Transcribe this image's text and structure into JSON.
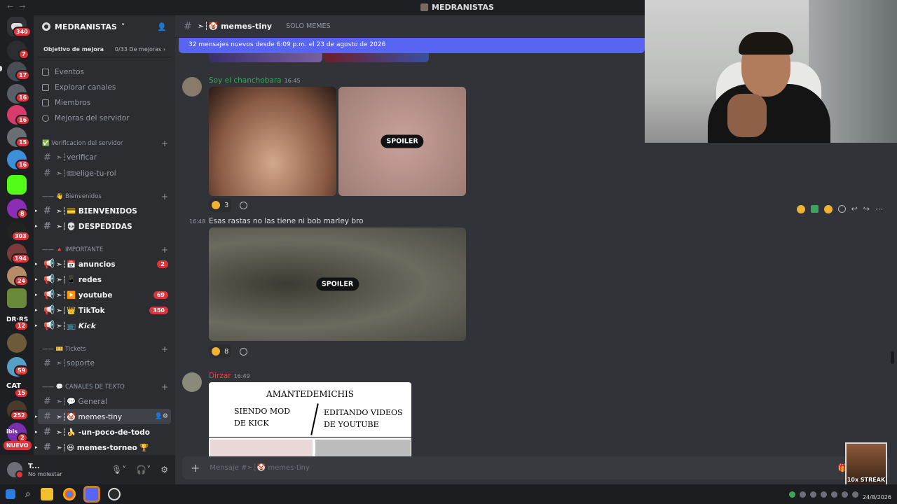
{
  "window": {
    "title": "MEDRANISTAS"
  },
  "rail": {
    "servers": [
      {
        "badge": "340"
      },
      {
        "badge": "7"
      },
      {
        "badge": "17"
      },
      {
        "badge": "16"
      },
      {
        "badge": "16"
      },
      {
        "badge": "15"
      },
      {
        "badge": "16"
      },
      {
        "badge": ""
      },
      {
        "badge": "8"
      },
      {
        "badge": "303"
      },
      {
        "badge": "194"
      },
      {
        "badge": "24"
      },
      {
        "badge": ""
      },
      {
        "badge": "12"
      },
      {
        "badge": ""
      },
      {
        "badge": "59"
      },
      {
        "badge": "15"
      },
      {
        "badge": "252"
      },
      {
        "badge": "2"
      }
    ],
    "text_dr": "DR·RS",
    "text_cat": "CAT",
    "text_ibis": "ibis",
    "nuevo": "NUEVO"
  },
  "sidebar": {
    "server_name": "MEDRANISTAS",
    "boost_label": "Objetivo de mejora",
    "boost_progress": "0/33 De mejoras",
    "menu": [
      "Eventos",
      "Explorar canales",
      "Miembros",
      "Mejoras del servidor"
    ],
    "categories": [
      {
        "name": "✅ Verificacion del servidor",
        "channels": [
          {
            "name": "➣┆verificar"
          },
          {
            "name": "➣┆🎟elige-tu-rol"
          }
        ]
      },
      {
        "name": "—— 👋 Bienvenidos",
        "channels": [
          {
            "name": "➣┆💳 𝗕𝗜𝗘𝗡𝗩𝗘𝗡𝗜𝗗𝗢𝗦"
          },
          {
            "name": "➣┆💀 𝗗𝗘𝗦𝗣𝗘𝗗𝗜𝗗𝗔𝗦"
          }
        ]
      },
      {
        "name": "—— 🔺 IMPORTANTE",
        "channels": [
          {
            "name": "➣┆📅 anuncios",
            "count": "2"
          },
          {
            "name": "➣┆📱 redes"
          },
          {
            "name": "➣┆▶️ youtube",
            "count": "69"
          },
          {
            "name": "➣┆👑 TikTok",
            "count": "350"
          },
          {
            "name": "➣┆📺 𝙆𝙞𝙘𝙠"
          }
        ]
      },
      {
        "name": "—— 🎫 Tickets",
        "channels": [
          {
            "name": "➣┆soporte"
          }
        ]
      },
      {
        "name": "—— 💬 CANALES DE TEXTO",
        "channels": [
          {
            "name": "➣┆💬 General"
          },
          {
            "name": "➣┆🤡 memes-tiny"
          },
          {
            "name": "➣┆🍌 -un-poco-de-todo"
          },
          {
            "name": "➣┆😆 memes-torneo 🏆"
          }
        ]
      }
    ]
  },
  "user": {
    "name": "T...",
    "status": "No molestar"
  },
  "chat": {
    "channel": "➣┆🤡 memes-tiny",
    "topic": "SOLO MEMES",
    "new_messages": "32 mensajes nuevos desde 6:09 p.m. el 23 de agosto de 2026",
    "messages": [
      {
        "author": "Soy el chanchobara",
        "author_color": "#3ba55c",
        "time": "16:45",
        "spoiler": "SPOILER",
        "reaction_count": "3"
      },
      {
        "time": "16:48",
        "text": "Esas rastas no las tiene ni bob marley bro",
        "spoiler": "SPOILER",
        "reaction_count": "8"
      },
      {
        "author": "Dirzar",
        "author_color": "#ed4245",
        "time": "16:49",
        "meme": {
          "title": "AMANTEDEMICHIS",
          "left_line1": "SIENDO MOD",
          "left_line2": "DE KICK",
          "right_line1": "EDITANDO VIDEOS",
          "right_line2": "DE YOUTUBE"
        }
      }
    ],
    "composer_placeholder": "Mensaje #➣┆🤡 memes-tiny"
  },
  "overlay": {
    "sticker_label": "10x STREAK"
  },
  "taskbar": {
    "time": "",
    "date": "24/8/2026"
  }
}
